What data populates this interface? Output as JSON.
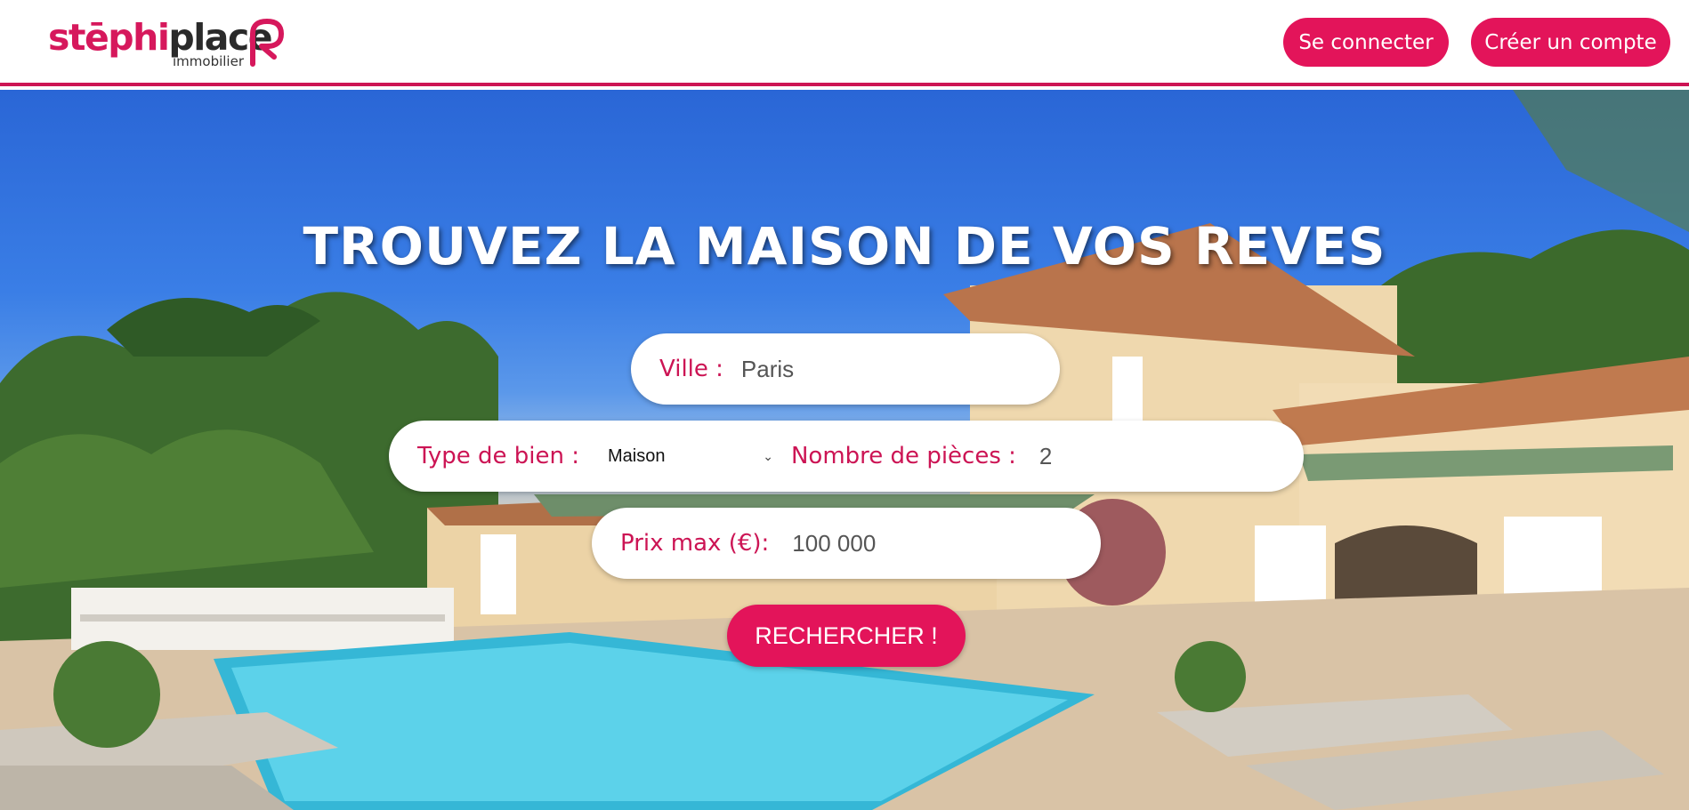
{
  "header": {
    "logo": {
      "part1": "stēphi",
      "part2": "place",
      "sub": "immobilier"
    },
    "login_label": "Se connecter",
    "signup_label": "Créer un compte"
  },
  "hero": {
    "headline": "TROUVEZ LA MAISON DE VOS REVES",
    "ville": {
      "label": "Ville :",
      "value": "Paris"
    },
    "type": {
      "label": "Type de bien :",
      "selected": "Maison"
    },
    "pieces": {
      "label": "Nombre de pièces :",
      "value": "2"
    },
    "prix": {
      "label": "Prix max (€):",
      "value": "100 000"
    },
    "search_label": "RECHERCHER !"
  },
  "colors": {
    "accent": "#e3145a",
    "label": "#cc1454"
  }
}
